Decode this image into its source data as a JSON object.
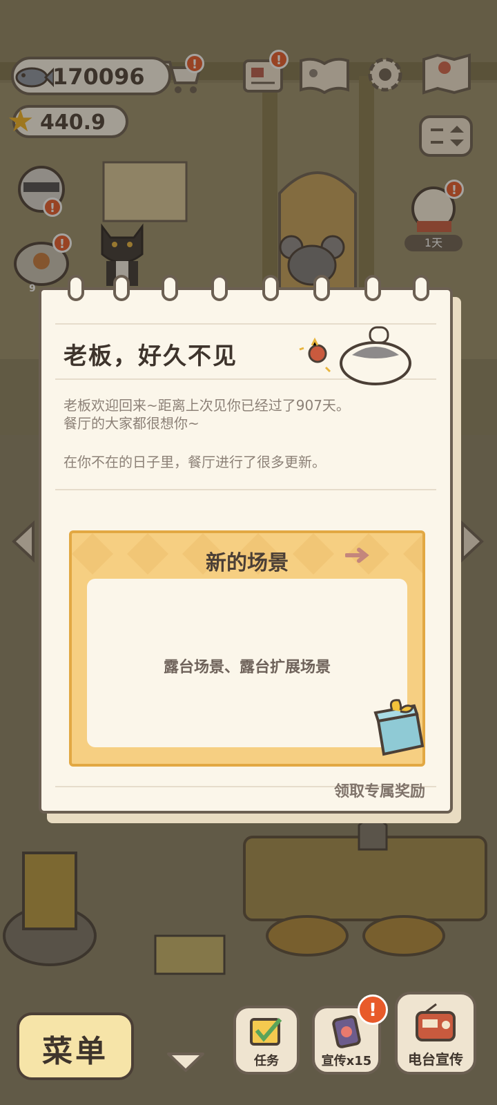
{
  "hud": {
    "fish_count": "170096",
    "star_count": "440.9",
    "cart_badge": "!",
    "mail_badge": "!"
  },
  "scene": {
    "cat_badge_1": "!",
    "cat_badge_2": "!",
    "cat_badge_3": "!",
    "cat_timer": "1天",
    "left_label": "9"
  },
  "dialog": {
    "title": "老板，好久不见",
    "message_line1": "老板欢迎回来~距离上次见你已经过了907天。",
    "message_line2": "餐厅的大家都很想你~",
    "message_line3": "在你不在的日子里，餐厅进行了很多更新。",
    "card_title": "新的场景",
    "card_content": "露台场景、露台扩展场景",
    "reward_link": "领取专属奖励"
  },
  "bottom_bar": {
    "menu_label": "菜单",
    "tasks_label": "任务",
    "promo_label": "宣传x15",
    "promo_badge": "!",
    "radio_label": "电台宣传"
  },
  "colors": {
    "accent_orange": "#e85a2a",
    "card_yellow": "#f6cf82",
    "paper": "#fbf6ea",
    "outline": "#6b5f52"
  }
}
